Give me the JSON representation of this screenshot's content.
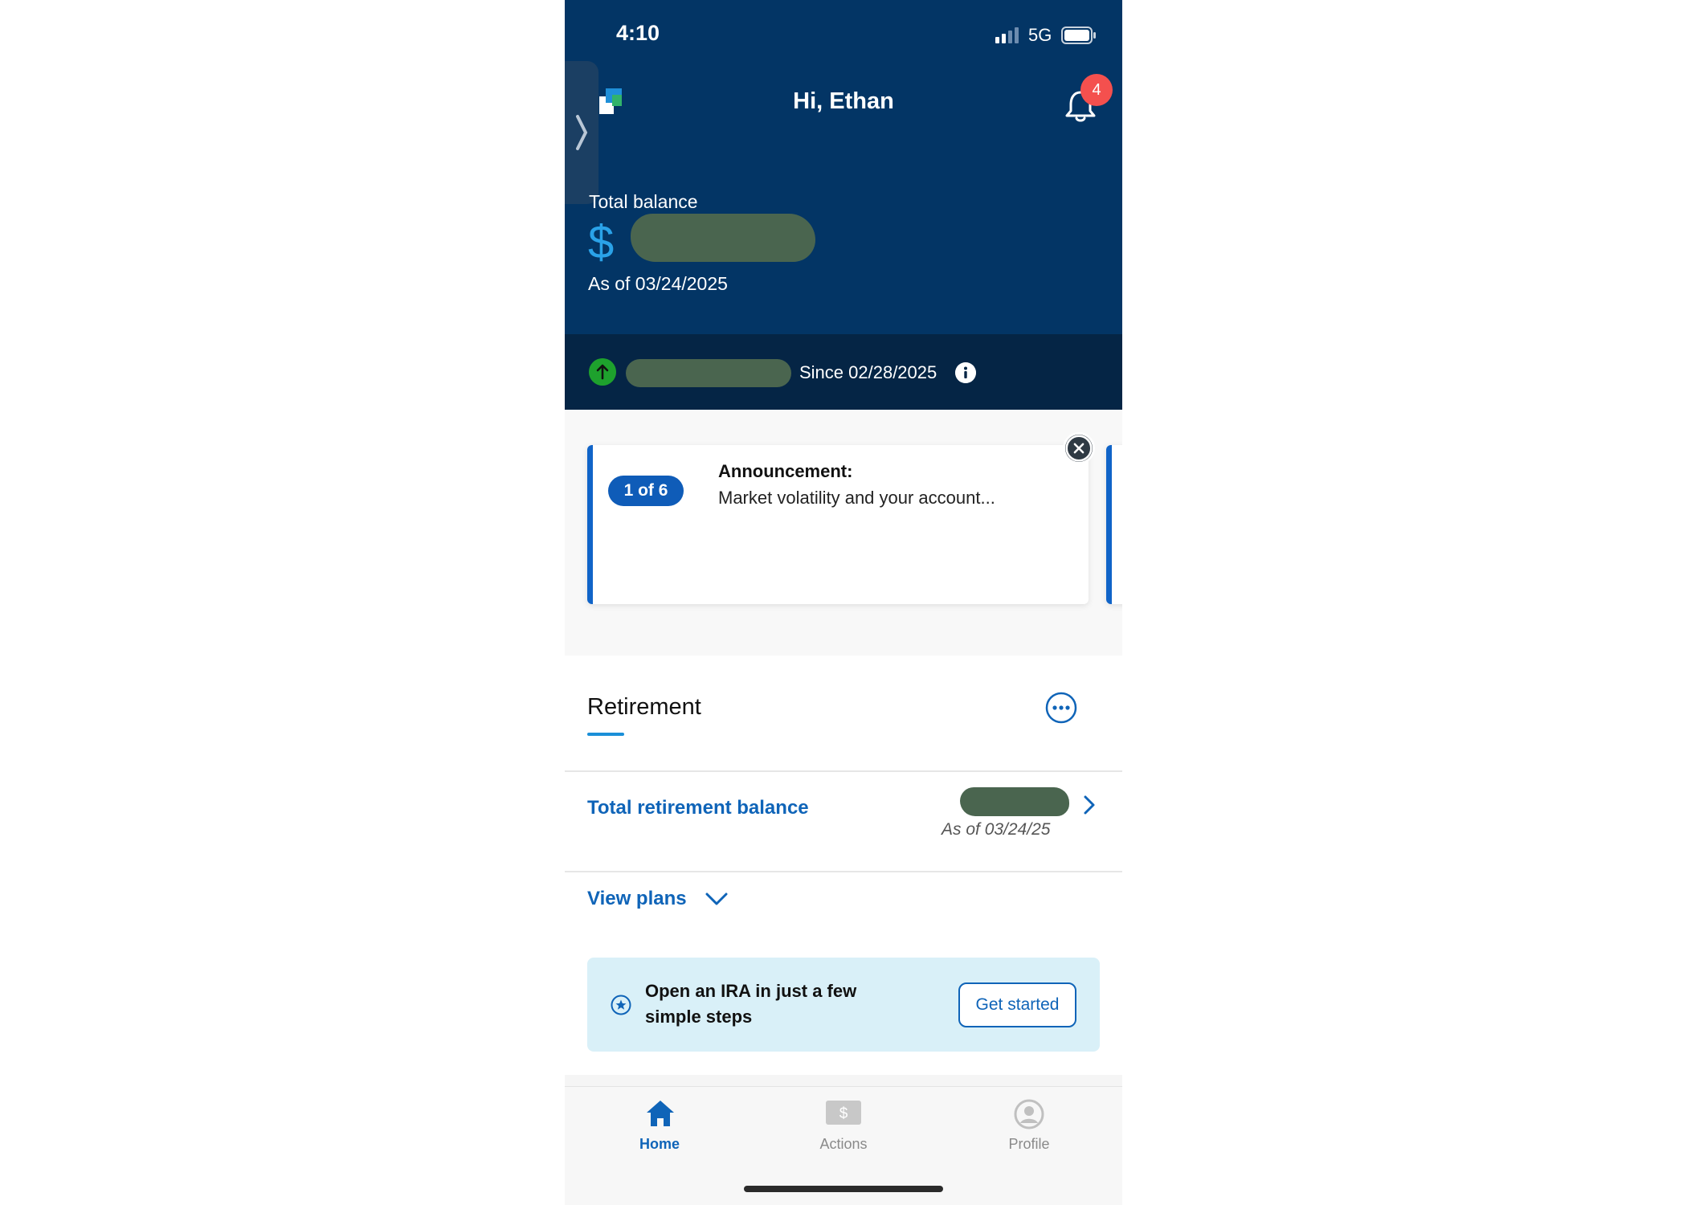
{
  "status_bar": {
    "time": "4:10",
    "network": "5G"
  },
  "header": {
    "greeting": "Hi, Ethan",
    "notification_count": "4",
    "total_balance_label": "Total balance",
    "currency_symbol": "$",
    "as_of": "As of 03/24/2025",
    "since": "Since 02/28/2025"
  },
  "announcement": {
    "position": "1 of 6",
    "title": "Announcement:",
    "body": "Market volatility and your account..."
  },
  "retirement": {
    "title": "Retirement",
    "total_label": "Total retirement balance",
    "as_of": "As of 03/24/25",
    "view_plans": "View plans"
  },
  "ira_banner": {
    "text": "Open an IRA in just a few simple steps",
    "button": "Get started"
  },
  "tabs": [
    {
      "label": "Home",
      "icon": "home-icon",
      "active": true
    },
    {
      "label": "Actions",
      "icon": "dollar-bill-icon",
      "active": false
    },
    {
      "label": "Profile",
      "icon": "profile-icon",
      "active": false
    }
  ],
  "colors": {
    "header_bg": "#033565",
    "accent": "#0f64b8",
    "positive": "#1ea12d",
    "badge": "#f4504e"
  }
}
